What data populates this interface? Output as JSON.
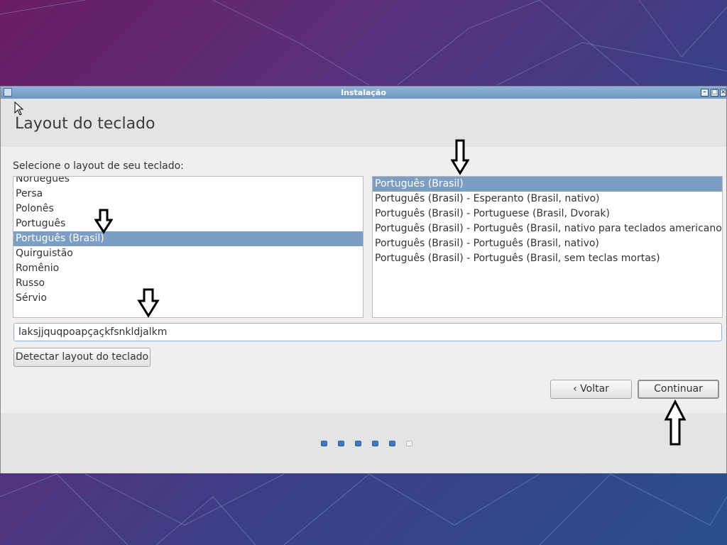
{
  "window": {
    "title": "Instalação"
  },
  "header": {
    "title": "Layout do teclado"
  },
  "layout_list": {
    "label": "Selecione o layout de seu teclado:",
    "items": [
      "Norueguês",
      "Persa",
      "Polonês",
      "Português",
      "Português (Brasil)",
      "Quirguistão",
      "Romênio",
      "Russo",
      "Sérvio"
    ],
    "selected": "Português (Brasil)"
  },
  "variant_list": {
    "items": [
      "Português (Brasil)",
      "Português (Brasil) - Esperanto (Brasil, nativo)",
      "Português (Brasil) - Portuguese (Brasil, Dvorak)",
      "Português (Brasil) - Português (Brasil, nativo para teclados americanos)",
      "Português (Brasil) - Português (Brasil, nativo)",
      "Português (Brasil) - Português (Brasil, sem teclas mortas)"
    ],
    "selected": "Português (Brasil)"
  },
  "test_field": {
    "value": "laksjjquqpoapçaçkfsnkldjalkm"
  },
  "buttons": {
    "detect": "Detectar layout do teclado",
    "back": "Voltar",
    "continue": "Continuar"
  },
  "progress": {
    "total_steps": 6,
    "completed_steps": 5
  },
  "colors": {
    "selection": "#7c9dc4",
    "titlebar": "#7fa4cf",
    "step_dot": "#3c79bd"
  }
}
